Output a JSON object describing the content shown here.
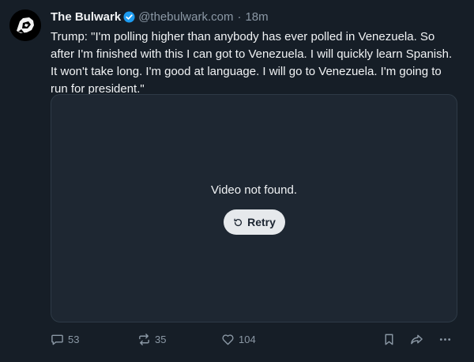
{
  "post": {
    "author": {
      "display_name": "The Bulwark",
      "verified": true,
      "handle": "@thebulwark.com",
      "separator": "·",
      "time": "18m",
      "avatar_icon": "bulwark-logo-icon"
    },
    "text": "Trump: \"I'm polling higher than anybody has ever polled in Venezuela. So after I'm finished with this I can got to Venezuela. I will quickly learn Spanish. It won't take long. I'm good at language. I will go to Venezuela. I'm going to run for president.\"",
    "video": {
      "message": "Video not found.",
      "retry_label": "Retry",
      "retry_icon": "refresh-icon"
    },
    "actions": {
      "replies": "53",
      "reposts": "35",
      "likes": "104"
    }
  },
  "colors": {
    "background": "#161e27",
    "text": "#f1f3f5",
    "muted": "#8b98a5",
    "verified": "#1d9bf0",
    "video_bg": "#1e2732",
    "button_bg": "#e6e9ec"
  }
}
